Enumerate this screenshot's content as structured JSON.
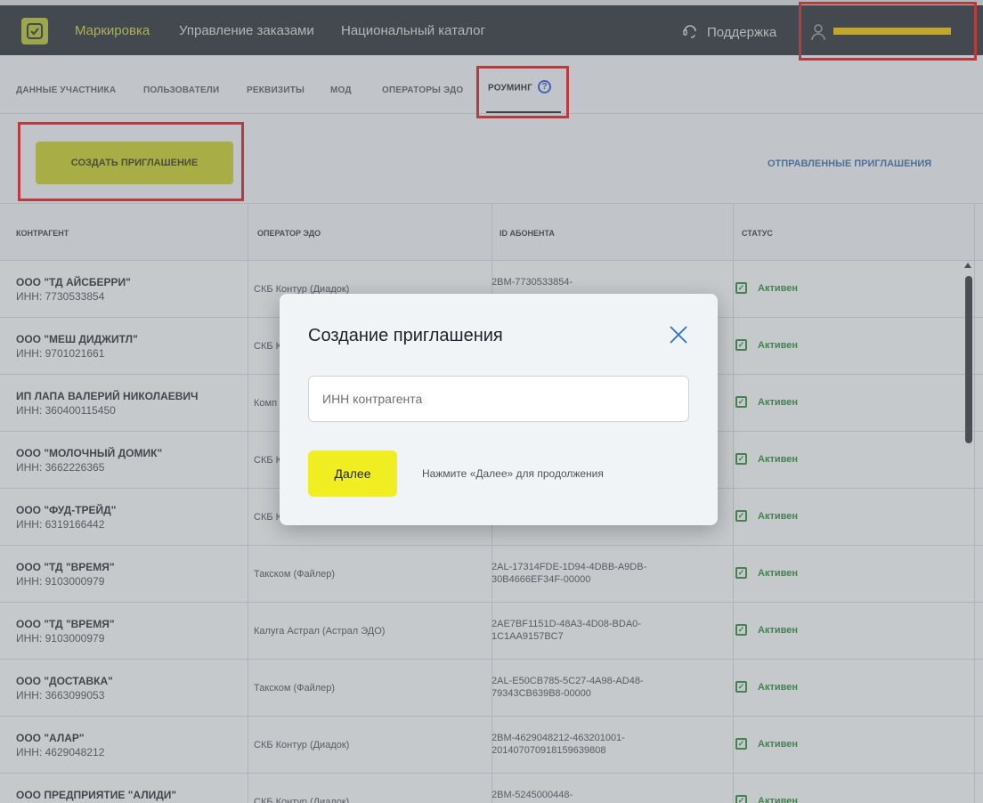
{
  "header": {
    "nav": [
      "Маркировка",
      "Управление заказами",
      "Национальный каталог"
    ],
    "support_label": "Поддержка"
  },
  "tabs": [
    "ДАННЫЕ УЧАСТНИКА",
    "ПОЛЬЗОВАТЕЛИ",
    "РЕКВИЗИТЫ",
    "МОД",
    "ОПЕРАТОРЫ ЭДО",
    "РОУМИНГ"
  ],
  "help_glyph": "?",
  "actions": {
    "create_label": "СОЗДАТЬ ПРИГЛАШЕНИЕ",
    "sent_label": "ОТПРАВЛЕННЫЕ ПРИГЛАШЕНИЯ"
  },
  "table": {
    "columns": [
      "КОНТРАГЕНТ",
      "ОПЕРАТОР ЭДО",
      "ID АБОНЕНТА",
      "СТАТУС"
    ],
    "rows": [
      {
        "name": "ООО \"ТД АЙСБЕРРИ\"",
        "inn": "ИНН: 7730533854",
        "operator": "СКБ Контур (Диадок)",
        "id": "2BM-7730533854-",
        "status": "Активен"
      },
      {
        "name": "ООО \"МЕШ ДИДЖИТЛ\"",
        "inn": "ИНН: 9701021661",
        "operator": "СКБ К",
        "id": "",
        "status": "Активен"
      },
      {
        "name": "ИП ЛАПА ВАЛЕРИЙ НИКОЛАЕВИЧ",
        "inn": "ИНН: 360400115450",
        "operator": "Комп",
        "id": "",
        "status": "Активен"
      },
      {
        "name": "ООО \"МОЛОЧНЫЙ ДОМИК\"",
        "inn": "ИНН: 3662226365",
        "operator": "СКБ К",
        "id": "",
        "status": "Активен"
      },
      {
        "name": "ООО \"ФУД-ТРЕЙД\"",
        "inn": "ИНН: 6319166442",
        "operator": "СКБ К",
        "id": "",
        "status": "Активен"
      },
      {
        "name": "ООО \"ТД \"ВРЕМЯ\"",
        "inn": "ИНН: 9103000979",
        "operator": "Такском (Файлер)",
        "id": "2AL-17314FDE-1D94-4DBB-A9DB-30B4666EF34F-00000",
        "status": "Активен"
      },
      {
        "name": "ООО \"ТД \"ВРЕМЯ\"",
        "inn": "ИНН: 9103000979",
        "operator": "Калуга Астрал (Астрал ЭДО)",
        "id": "2AE7BF1151D-48A3-4D08-BDA0-1C1AA9157BC7",
        "status": "Активен"
      },
      {
        "name": "ООО \"ДОСТАВКА\"",
        "inn": "ИНН: 3663099053",
        "operator": "Такском (Файлер)",
        "id": "2AL-E50CB785-5C27-4A98-AD48-79343CB639B8-00000",
        "status": "Активен"
      },
      {
        "name": "ООО \"АЛАР\"",
        "inn": "ИНН: 4629048212",
        "operator": "СКБ Контур (Диадок)",
        "id": "2BM-4629048212-463201001-201407070918159639808",
        "status": "Активен"
      },
      {
        "name": "ООО ПРЕДПРИЯТИЕ \"АЛИДИ\"",
        "inn": "",
        "operator": "СКБ Контур (Диадок)",
        "id": "2BM-5245000448-",
        "status": "Активен"
      }
    ]
  },
  "modal": {
    "title": "Создание приглашения",
    "input_placeholder": "ИНН контрагента",
    "next_label": "Далее",
    "hint": "Нажмите «Далее» для продолжения"
  },
  "colors": {
    "topbar": "#2d3338",
    "accent_yellow": "#f0ee23",
    "active_green": "#2f8a3a",
    "highlight_red": "#e02020",
    "link_blue": "#3b6fa8"
  }
}
